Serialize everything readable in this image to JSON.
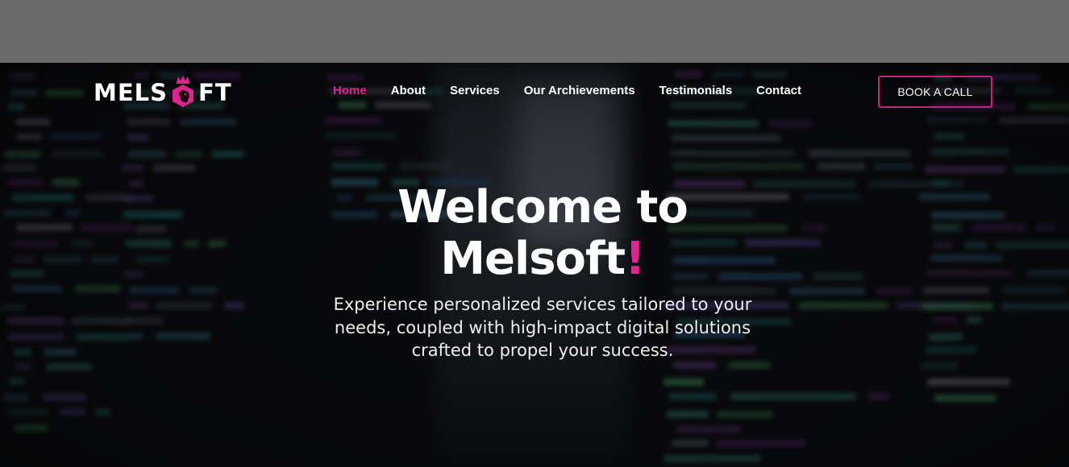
{
  "header": {
    "logo": {
      "text_left": "MELS",
      "text_right": "FT",
      "mark_icon": "crowned-lion-hexagon-icon",
      "accent_color": "#e0248f"
    },
    "nav": {
      "items": [
        {
          "label": "Home",
          "active": true
        },
        {
          "label": "About",
          "active": false
        },
        {
          "label": "Services",
          "active": false
        },
        {
          "label": "Our Archievements",
          "active": false
        },
        {
          "label": "Testimonials",
          "active": false
        },
        {
          "label": "Contact",
          "active": false
        }
      ]
    },
    "cta_label": "BOOK A CALL"
  },
  "hero": {
    "headline_line1": "Welcome to",
    "headline_line2": "Melsoft",
    "headline_accent": "!",
    "subtitle": "Experience personalized services tailored to your needs, coupled with high-impact digital solutions crafted to propel your success."
  },
  "colors": {
    "accent": "#e0248f",
    "background": "#0f1014",
    "top_band": "#6b6b6b"
  }
}
